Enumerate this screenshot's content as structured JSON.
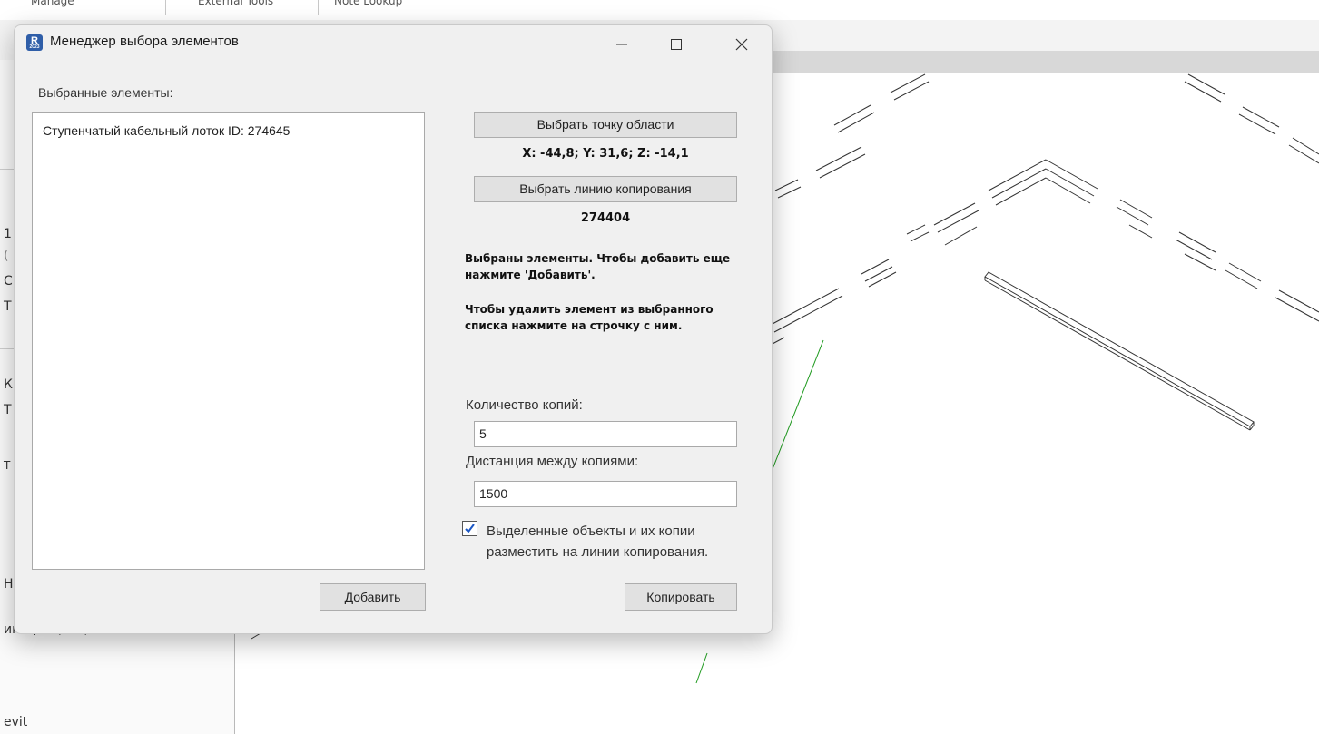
{
  "app": {
    "top_tabs": [
      "Manage",
      "External Tools",
      "Note Lookup"
    ],
    "left_fragments": [
      "1",
      "(",
      "С",
      "Т",
      "К",
      "Т",
      "Т",
      "Н",
      "икации (все)",
      "evit"
    ]
  },
  "dialog": {
    "title": "Менеджер выбора элементов",
    "icon_letter": "R",
    "icon_sub": "2023",
    "selected_label": "Выбранные элементы:",
    "selected_items": [
      "Ступенчатый кабельный лоток ID: 274645"
    ],
    "pick_point_button": "Выбрать точку области",
    "coordinates": "X: -44,8; Y: 31,6; Z: -14,1",
    "pick_line_button": "Выбрать линию копирования",
    "line_id": "274404",
    "note_add": "Выбраны элементы. Чтобы добавить еще нажмите 'Добавить'.",
    "note_remove": "Чтобы удалить элемент из выбранного списка нажмите на строчку с ним.",
    "copies_label": "Количество копий:",
    "copies_value": "5",
    "distance_label": "Дистанция между копиями:",
    "distance_value": "1500",
    "place_on_line_checked": true,
    "place_on_line_label": "Выделенные объекты и их копии разместить на линии копирования.",
    "add_button": "Добавить",
    "copy_button": "Копировать"
  },
  "colors": {
    "dialog_bg": "#f0f0f0",
    "button_bg": "#e1e1e1",
    "icon_blue": "#2f5ea8",
    "green_axis": "#1e9a1e"
  },
  "icons": [
    "minimize-icon",
    "maximize-icon",
    "close-icon",
    "checkmark-icon",
    "revit-app-icon"
  ]
}
